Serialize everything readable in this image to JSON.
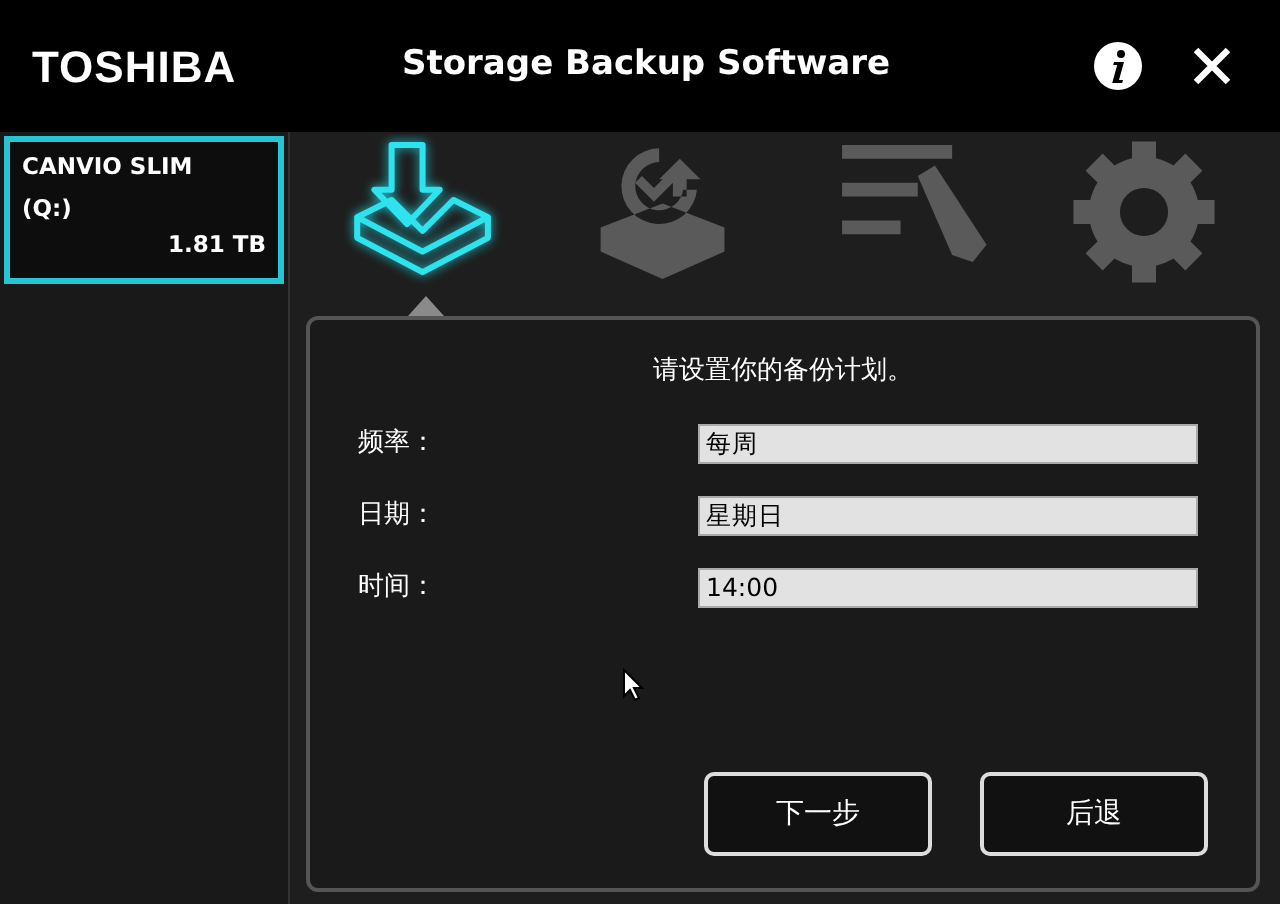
{
  "header": {
    "brand": "TOSHIBA",
    "title": "Storage Backup Software"
  },
  "devices": [
    {
      "name": "CANVIO SLIM",
      "drive": "(Q:)",
      "size": "1.81 TB",
      "selected": true
    }
  ],
  "tabs": [
    {
      "kind": "backup",
      "selected": true
    },
    {
      "kind": "restore",
      "selected": false
    },
    {
      "kind": "log",
      "selected": false
    },
    {
      "kind": "settings",
      "selected": false
    }
  ],
  "form": {
    "heading": "请设置你的备份计划。",
    "fields": [
      {
        "label": "频率：",
        "value": "每周"
      },
      {
        "label": "日期：",
        "value": "星期日"
      },
      {
        "label": "时间：",
        "value": "14:00"
      }
    ],
    "buttons": [
      "下一步",
      "后退"
    ]
  }
}
